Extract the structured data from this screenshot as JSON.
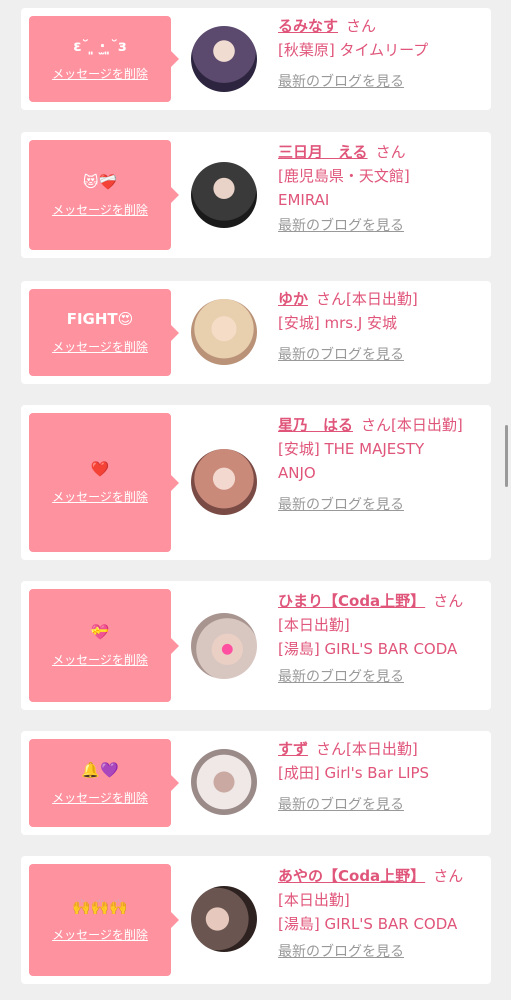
{
  "cards": [
    {
      "message": "ε˘ ͈ ·̫ ͈˘з",
      "delete_label": "メッセージを削除",
      "name": "るみなす",
      "san": "さん",
      "status": "",
      "shop": "[秋葉原] タイムリープ",
      "blog_label": "最新のブログを見る",
      "avatar_colors": [
        "#5b4a6d",
        "#2d2540"
      ]
    },
    {
      "message": "😻❤️‍🩹",
      "delete_label": "メッセージを削除",
      "name": "三日月　える",
      "san": "さん",
      "status": "",
      "shop": "[鹿児島県・天文館] EMIRAI",
      "blog_label": "最新のブログを見る",
      "avatar_colors": [
        "#3a3a3a",
        "#1a1a1a"
      ]
    },
    {
      "message": "FIGHT😍",
      "delete_label": "メッセージを削除",
      "name": "ゆか",
      "san": "さん",
      "status": "[本日出勤]",
      "shop": "[安城] mrs.J 安城",
      "blog_label": "最新のブログを見る",
      "avatar_colors": [
        "#e8cfae",
        "#b99277"
      ]
    },
    {
      "message": "❤️",
      "delete_label": "メッセージを削除",
      "name": "星乃　はる",
      "san": "さん",
      "status": "[本日出勤]",
      "shop": "[安城] THE MAJESTY ANJO",
      "blog_label": "最新のブログを見る",
      "avatar_colors": [
        "#c98a7a",
        "#7a4a45"
      ]
    },
    {
      "message": "💝",
      "delete_label": "メッセージを削除",
      "name": "ひまり【Coda上野】",
      "san": "さん",
      "status": "[本日出勤]",
      "shop": "[湯島] GIRL'S BAR CODA",
      "blog_label": "最新のブログを見る",
      "avatar_colors": [
        "#d8c6c0",
        "#a89590"
      ]
    },
    {
      "message": "🔔💜",
      "delete_label": "メッセージを削除",
      "name": "すず",
      "san": "さん",
      "status": "[本日出勤]",
      "shop": "[成田] Girl's Bar LIPS",
      "blog_label": "最新のブログを見る",
      "avatar_colors": [
        "#efe8e6",
        "#9a8a88"
      ]
    },
    {
      "message": "🙌🙌🙌",
      "delete_label": "メッセージを削除",
      "name": "あやの【Coda上野】",
      "san": "さん",
      "status": "[本日出勤]",
      "shop": "[湯島] GIRL'S BAR CODA",
      "blog_label": "最新のブログを見る",
      "avatar_colors": [
        "#6a5550",
        "#2e2220"
      ]
    }
  ],
  "colors": {
    "accent": "#e0557a",
    "bubble": "#ff929f",
    "background": "#efefef"
  }
}
